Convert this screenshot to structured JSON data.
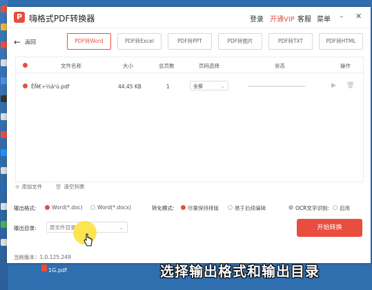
{
  "app": {
    "title": "嗨格式PDF转换器",
    "logo_letter": "P"
  },
  "menu": {
    "login": "登录",
    "vip": "开通VIP",
    "service": "客服",
    "more": "菜单"
  },
  "window_controls": {
    "minimize": "–",
    "close": "✕"
  },
  "back_label": "返回",
  "tabs": [
    {
      "label": "PDF转Word",
      "active": true
    },
    {
      "label": "PDF转Excel",
      "active": false
    },
    {
      "label": "PDF转PPT",
      "active": false
    },
    {
      "label": "PDF转图片",
      "active": false
    },
    {
      "label": "PDF转TXT",
      "active": false
    },
    {
      "label": "PDF转HTML",
      "active": false
    }
  ],
  "table": {
    "headers": {
      "name": "文件名称",
      "size": "大小",
      "pages": "总页数",
      "page_select": "页码选择",
      "status": "状态",
      "action": "操作"
    },
    "rows": [
      {
        "name": "ÊÑ€÷½à¹ú.pdf",
        "size": "44.45 KB",
        "pages": "1",
        "page_select": "全部",
        "progress": 0.0
      }
    ]
  },
  "add_file": "添加文件",
  "clear_list": "清空列表",
  "output_format": {
    "label": "输出格式:",
    "options": [
      {
        "label": "Word(*.doc)",
        "selected": true
      },
      {
        "label": "Word(*.docx)",
        "selected": false
      }
    ]
  },
  "convert_mode": {
    "label": "转化模式:",
    "options": [
      {
        "label": "尽量保持排版",
        "selected": true
      },
      {
        "label": "易于后续编辑",
        "selected": false
      }
    ]
  },
  "ocr": {
    "label": "OCR文字识别:",
    "option": "启用"
  },
  "output_dir": {
    "label": "输出目录:",
    "value": "原文件目录"
  },
  "convert_button": "开始转换",
  "version": "当前版本：1.0.125.249",
  "desktop_file_label": "1G.pdf",
  "caption": "选择输出格式和输出目录",
  "colors": {
    "accent": "#e84d3d",
    "desktop": "#2f6fb0",
    "highlight": "#fae132"
  }
}
